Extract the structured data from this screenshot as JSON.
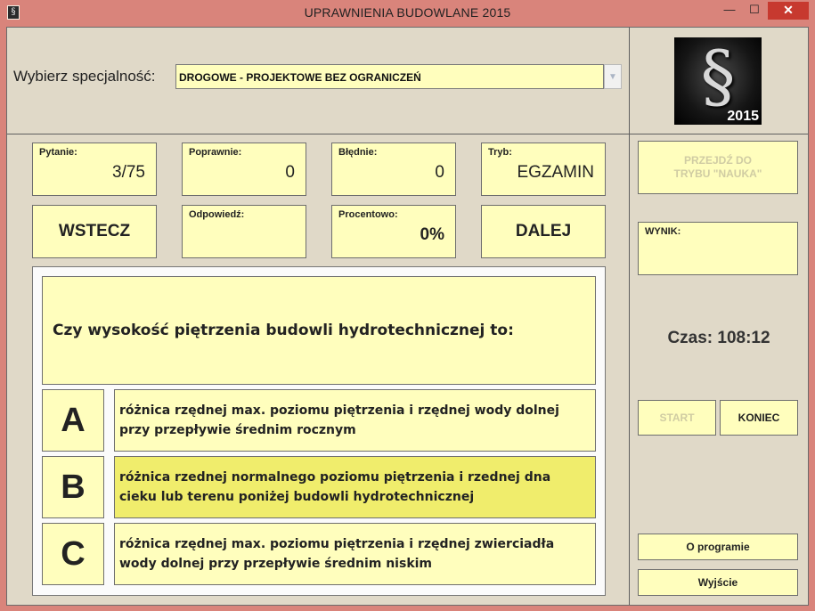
{
  "window": {
    "title": "UPRAWNIENIA BUDOWLANE 2015",
    "close_glyph": "✕",
    "min_glyph": "—",
    "max_glyph": "☐",
    "icon_glyph": "§"
  },
  "specialty": {
    "label": "Wybierz specjalność:",
    "value": "DROGOWE - PROJEKTOWE BEZ OGRANICZEŃ",
    "arrow": "▼"
  },
  "logo": {
    "symbol": "§",
    "year": "2015"
  },
  "stats": {
    "question_label": "Pytanie:",
    "question_value": "3/75",
    "correct_label": "Poprawnie:",
    "correct_value": "0",
    "wrong_label": "Błędnie:",
    "wrong_value": "0",
    "mode_label": "Tryb:",
    "mode_value": "EGZAMIN",
    "answer_label": "Odpowiedź:",
    "answer_value": "",
    "percent_label": "Procentowo:",
    "percent_value": "0%"
  },
  "nav": {
    "back": "WSTECZ",
    "next": "DALEJ"
  },
  "question": {
    "text": "Czy wysokość piętrzenia budowli hydrotechnicznej to:",
    "answers": [
      {
        "letter": "A",
        "text": "różnica rzędnej max. poziomu piętrzenia i rzędnej wody dolnej przy przepływie średnim rocznym",
        "selected": false
      },
      {
        "letter": "B",
        "text": "różnica rzednej normalnego poziomu piętrzenia i rzednej dna cieku lub terenu poniżej budowli hydrotechnicznej",
        "selected": true
      },
      {
        "letter": "C",
        "text": "różnica rzędnej max. poziomu piętrzenia i rzędnej zwierciadła wody dolnej przy przepływie średnim niskim",
        "selected": false
      }
    ]
  },
  "side": {
    "learn_mode": "PRZEJDŹ DO TRYBU \"NAUKA\"",
    "result_label": "WYNIK:",
    "timer": "Czas: 108:12",
    "start": "START",
    "end": "KONIEC",
    "about": "O programie",
    "exit": "Wyjście"
  },
  "colors": {
    "frame": "#d9847b",
    "panel": "#e0d9c8",
    "cell": "#fffebd",
    "selected_answer": "#f0ed6c",
    "close": "#c7392f"
  }
}
